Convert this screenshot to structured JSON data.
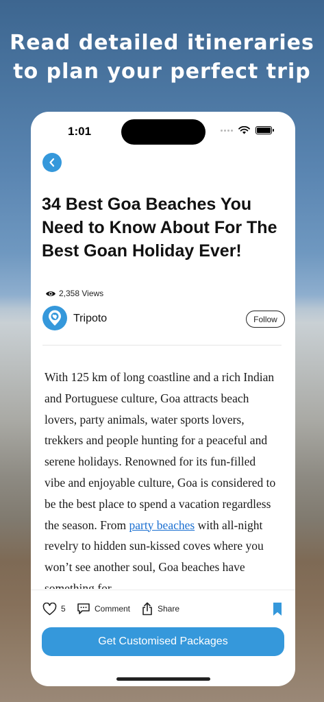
{
  "promo": {
    "headline_line1": "Read detailed itineraries",
    "headline_line2": "to plan your perfect trip"
  },
  "status_bar": {
    "time": "1:01"
  },
  "article": {
    "title": "34 Best Goa Beaches You Need to Know About For The Best Goan Holiday Ever!",
    "views": "2,358 Views",
    "author": "Tripoto",
    "follow_label": "Follow",
    "body_part1": "With 125 km of long coastline and a rich Indian and Portuguese culture, Goa attracts beach lovers, party animals, water sports lovers, trekkers and people hunting for a peaceful and serene holidays. Renowned for its fun-filled vibe and enjoyable culture, Goa is considered to be the best place to spend a vacation regardless the season. From ",
    "body_link": "party beaches",
    "body_part2": " with all-night revelry to hidden sun-kissed coves where you won’t see another soul, Goa beaches have something for"
  },
  "actions": {
    "likes": "5",
    "comment_label": "Comment",
    "share_label": "Share"
  },
  "cta": {
    "label": "Get Customised Packages"
  },
  "icons": {
    "back": "chevron-left-icon",
    "views": "eye-icon",
    "author_logo": "globe-pin-icon",
    "like": "heart-icon",
    "comment": "comment-icon",
    "share": "share-icon",
    "bookmark": "bookmark-icon"
  },
  "colors": {
    "accent": "#3598db",
    "link": "#1a6fd1"
  }
}
